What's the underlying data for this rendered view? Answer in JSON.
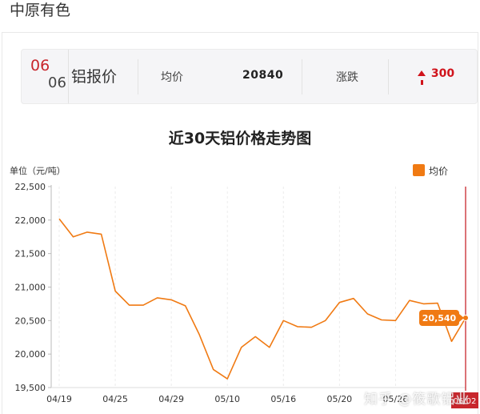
{
  "page": {
    "title": "中原有色"
  },
  "price_bar": {
    "month": "06",
    "day": "06",
    "metal": "铝报价",
    "avg_label": "均价",
    "avg_value": "20840",
    "change_label": "涨跌",
    "change_value": "300",
    "change_direction": "up",
    "up_color": "#d0131b"
  },
  "chart_data": {
    "type": "line",
    "title": "近30天铝价格走势图",
    "ylabel": "单位（元/吨）",
    "legend": "均价",
    "legend_position": "top-right",
    "color": "#f07a13",
    "ylim": [
      19500,
      22500
    ],
    "yticks": [
      "19,500",
      "20,000",
      "20,500",
      "21,000",
      "21,500",
      "22,000",
      "22,500"
    ],
    "ytick_values": [
      19500,
      20000,
      20500,
      21000,
      21500,
      22000,
      22500
    ],
    "xticks": [
      "04/19",
      "04/25",
      "04/29",
      "05/10",
      "05/16",
      "05/20",
      "05/26",
      "06/02"
    ],
    "xtick_index": [
      0,
      4,
      8,
      12,
      16,
      20,
      24,
      29
    ],
    "categories": [
      "04/19",
      "04/20",
      "04/21",
      "04/22",
      "04/25",
      "04/26",
      "04/27",
      "04/28",
      "04/29",
      "05/05",
      "05/06",
      "05/09",
      "05/10",
      "05/11",
      "05/12",
      "05/13",
      "05/16",
      "05/17",
      "05/18",
      "05/19",
      "05/20",
      "05/23",
      "05/24",
      "05/25",
      "05/26",
      "05/27",
      "05/30",
      "05/31",
      "06/01",
      "06/02"
    ],
    "series": [
      {
        "name": "均价",
        "values": [
          22020,
          21750,
          21820,
          21790,
          20940,
          20730,
          20730,
          20840,
          20810,
          20720,
          20290,
          19770,
          19630,
          20100,
          20260,
          20100,
          20500,
          20410,
          20400,
          20500,
          20770,
          20830,
          20600,
          20510,
          20500,
          20800,
          20750,
          20760,
          20190,
          20540
        ]
      }
    ],
    "highlight": {
      "label": "20,540",
      "index": 29,
      "date": "06/02"
    },
    "grid": {
      "vertical": true,
      "horizontal": false
    }
  },
  "watermark": "知乎 @筱歌铝业"
}
